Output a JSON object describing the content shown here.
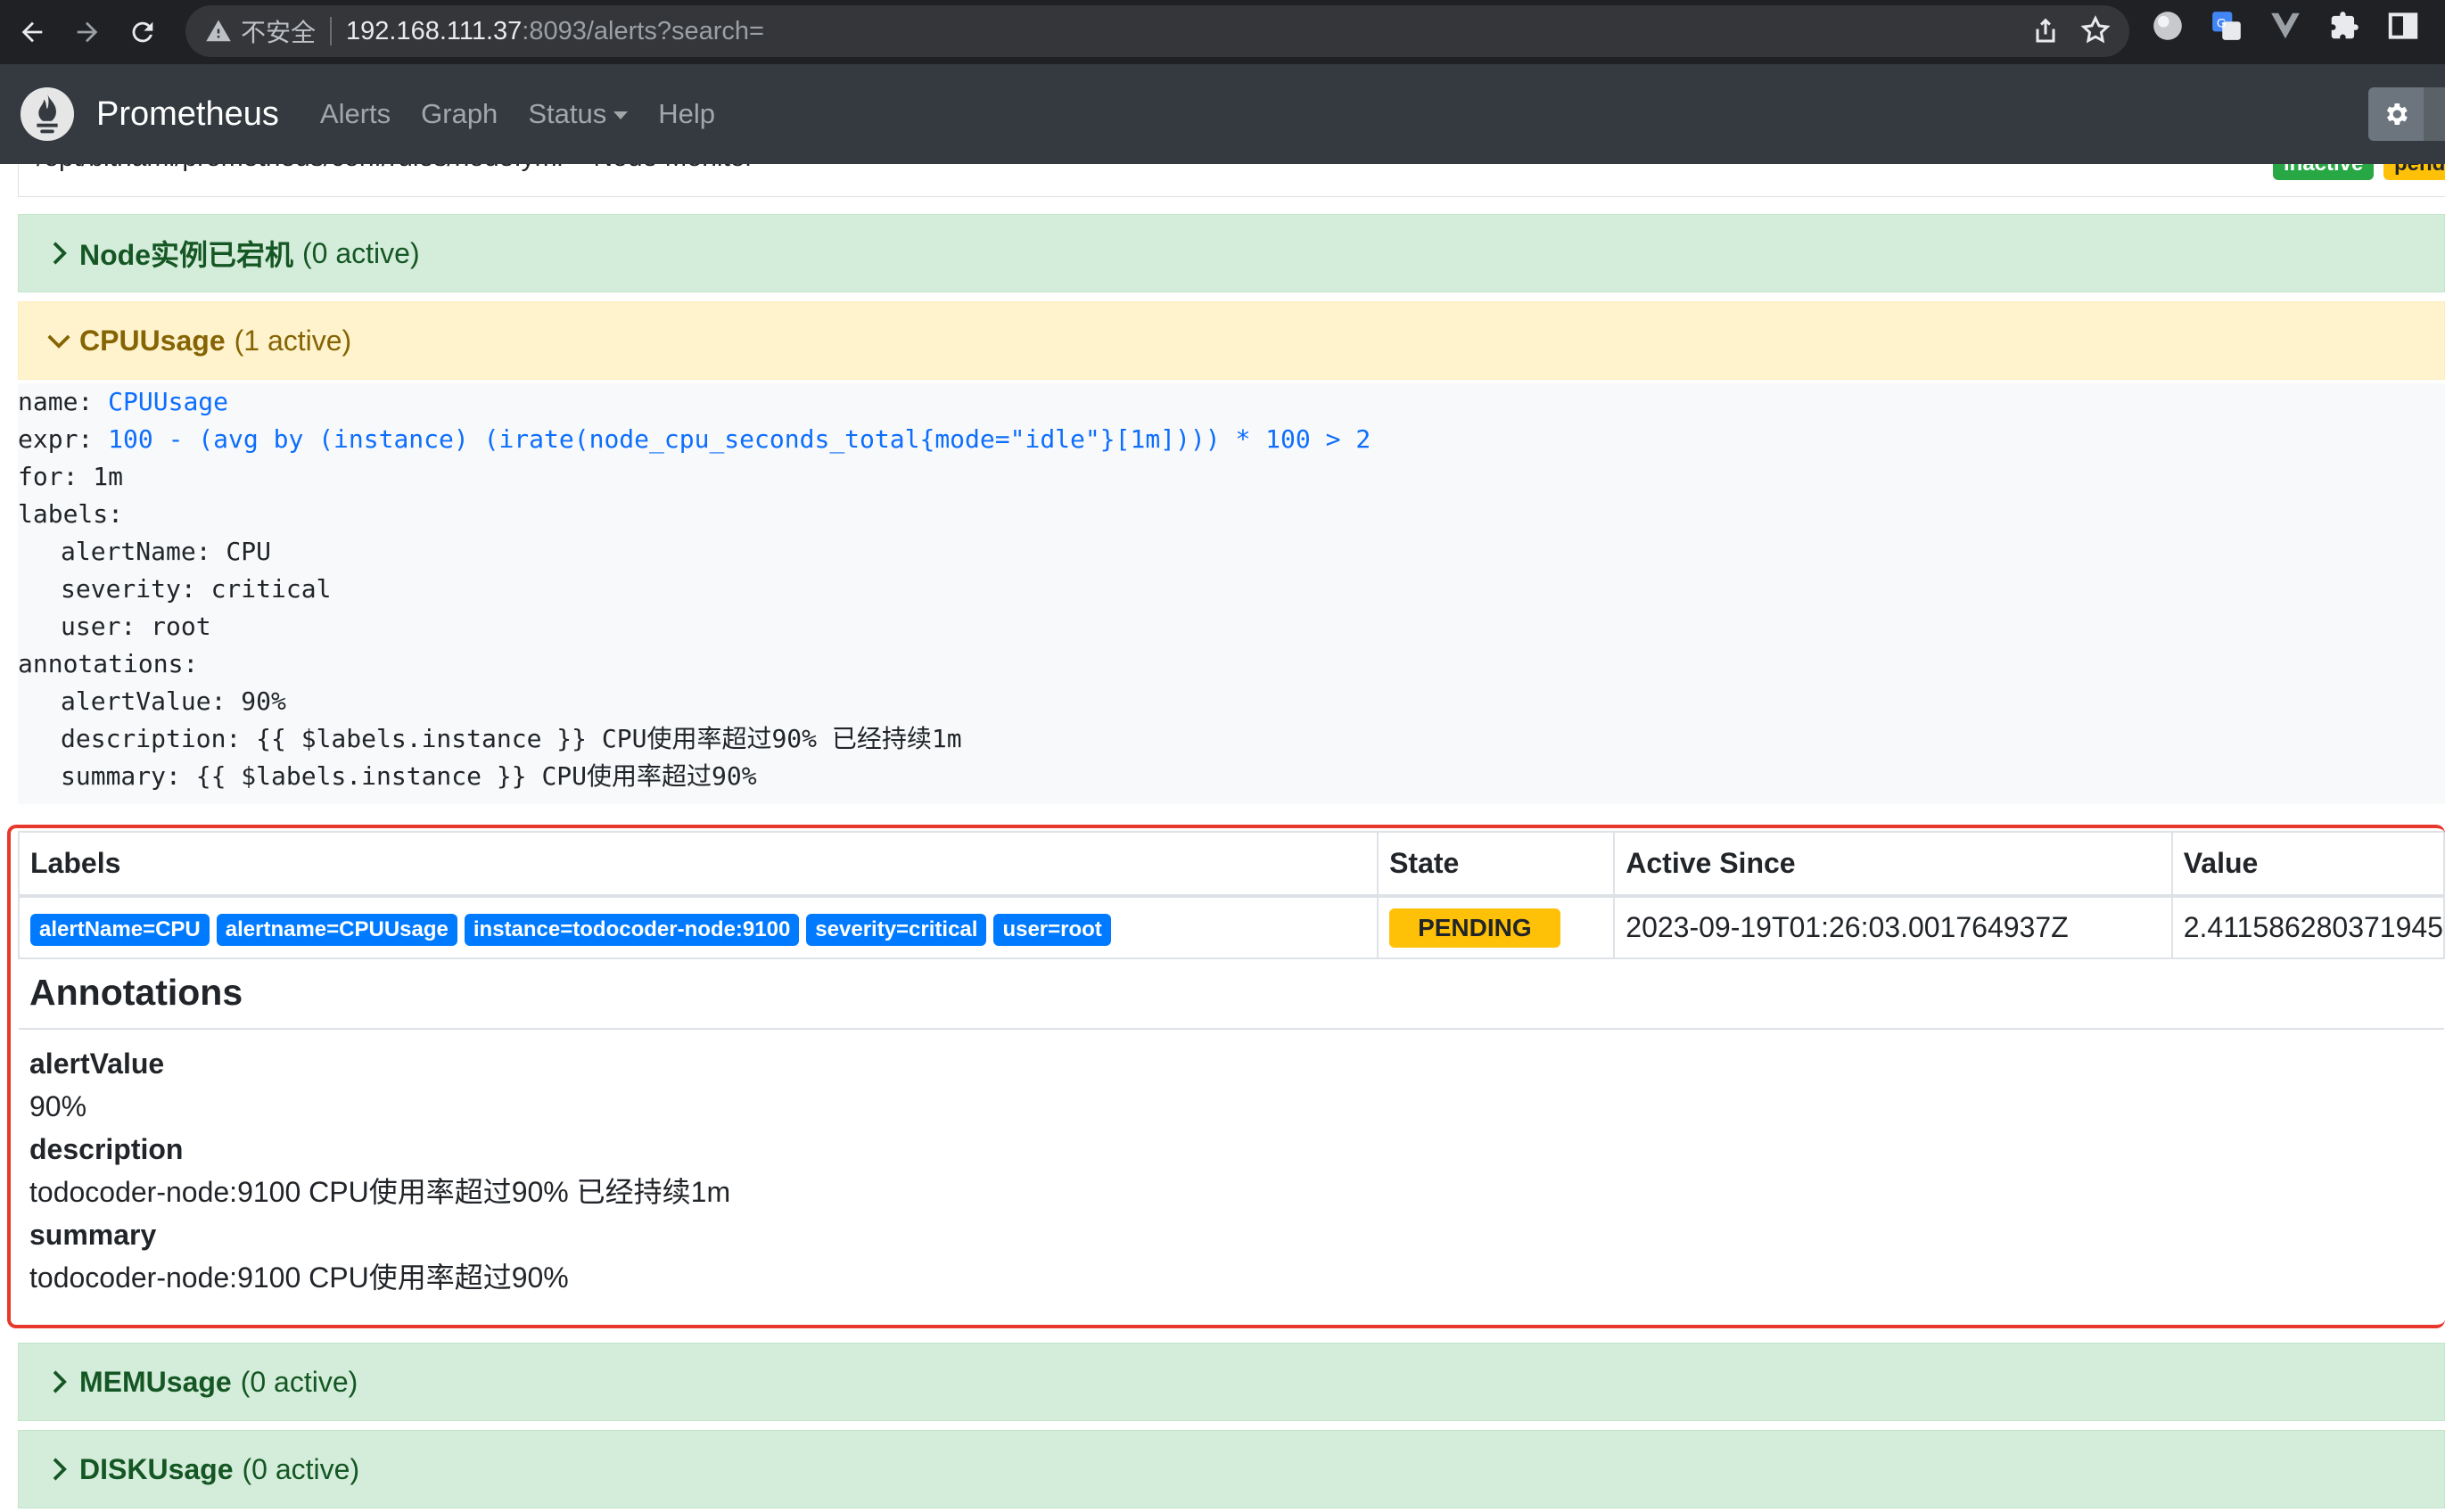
{
  "browser": {
    "insecure_label": "不安全",
    "url_host": "192.168.111.37",
    "url_path": ":8093/alerts?search="
  },
  "navbar": {
    "brand": "Prometheus",
    "links": [
      "Alerts",
      "Graph",
      "Status",
      "Help"
    ]
  },
  "rule_file_row": {
    "path": "/opt/bitnami/prometheus/conf/rules/node.yml > Node Monitor",
    "badge_inactive": "inactive",
    "badge_pending": "pending"
  },
  "groups": [
    {
      "name": "Node实例已宕机",
      "count": "(0 active)",
      "state": "inactive",
      "expanded": false
    },
    {
      "name": "CPUUsage",
      "count": "(1 active)",
      "state": "pending",
      "expanded": true
    },
    {
      "name": "MEMUsage",
      "count": "(0 active)",
      "state": "inactive",
      "expanded": false
    },
    {
      "name": "DISKUsage",
      "count": "(0 active)",
      "state": "inactive",
      "expanded": false
    }
  ],
  "rule": {
    "name_key": "name: ",
    "name": "CPUUsage",
    "expr_key": "expr: ",
    "expr": "100 - (avg by (instance) (irate(node_cpu_seconds_total{mode=\"idle\"}[1m]))) * 100 > 2",
    "for_line": "for: 1m",
    "labels_key": "labels:",
    "labels": [
      "alertName: CPU",
      "severity: critical",
      "user: root"
    ],
    "annotations_key": "annotations:",
    "annotations": [
      "alertValue: 90%",
      "description: {{ $labels.instance }} CPU使用率超过90% 已经持续1m",
      "summary: {{ $labels.instance }} CPU使用率超过90%"
    ]
  },
  "table": {
    "headers": [
      "Labels",
      "State",
      "Active Since",
      "Value"
    ],
    "row": {
      "labels": [
        "alertName=CPU",
        "alertname=CPUUsage",
        "instance=todocoder-node:9100",
        "severity=critical",
        "user=root"
      ],
      "state": "PENDING",
      "active_since": "2023-09-19T01:26:03.001764937Z",
      "value": "2.411586280371945"
    },
    "annotations_title": "Annotations",
    "annotations": [
      {
        "key": "alertValue",
        "value": "90%"
      },
      {
        "key": "description",
        "value": "todocoder-node:9100 CPU使用率超过90% 已经持续1m"
      },
      {
        "key": "summary",
        "value": "todocoder-node:9100 CPU使用率超过90%"
      }
    ]
  },
  "colors": {
    "navbar_bg": "#343a40",
    "inactive_bg": "#d4edda",
    "pending_bg": "#fff3cd",
    "label_badge": "#007bff",
    "pending_badge": "#ffc107",
    "highlight_border": "#e8382c"
  }
}
